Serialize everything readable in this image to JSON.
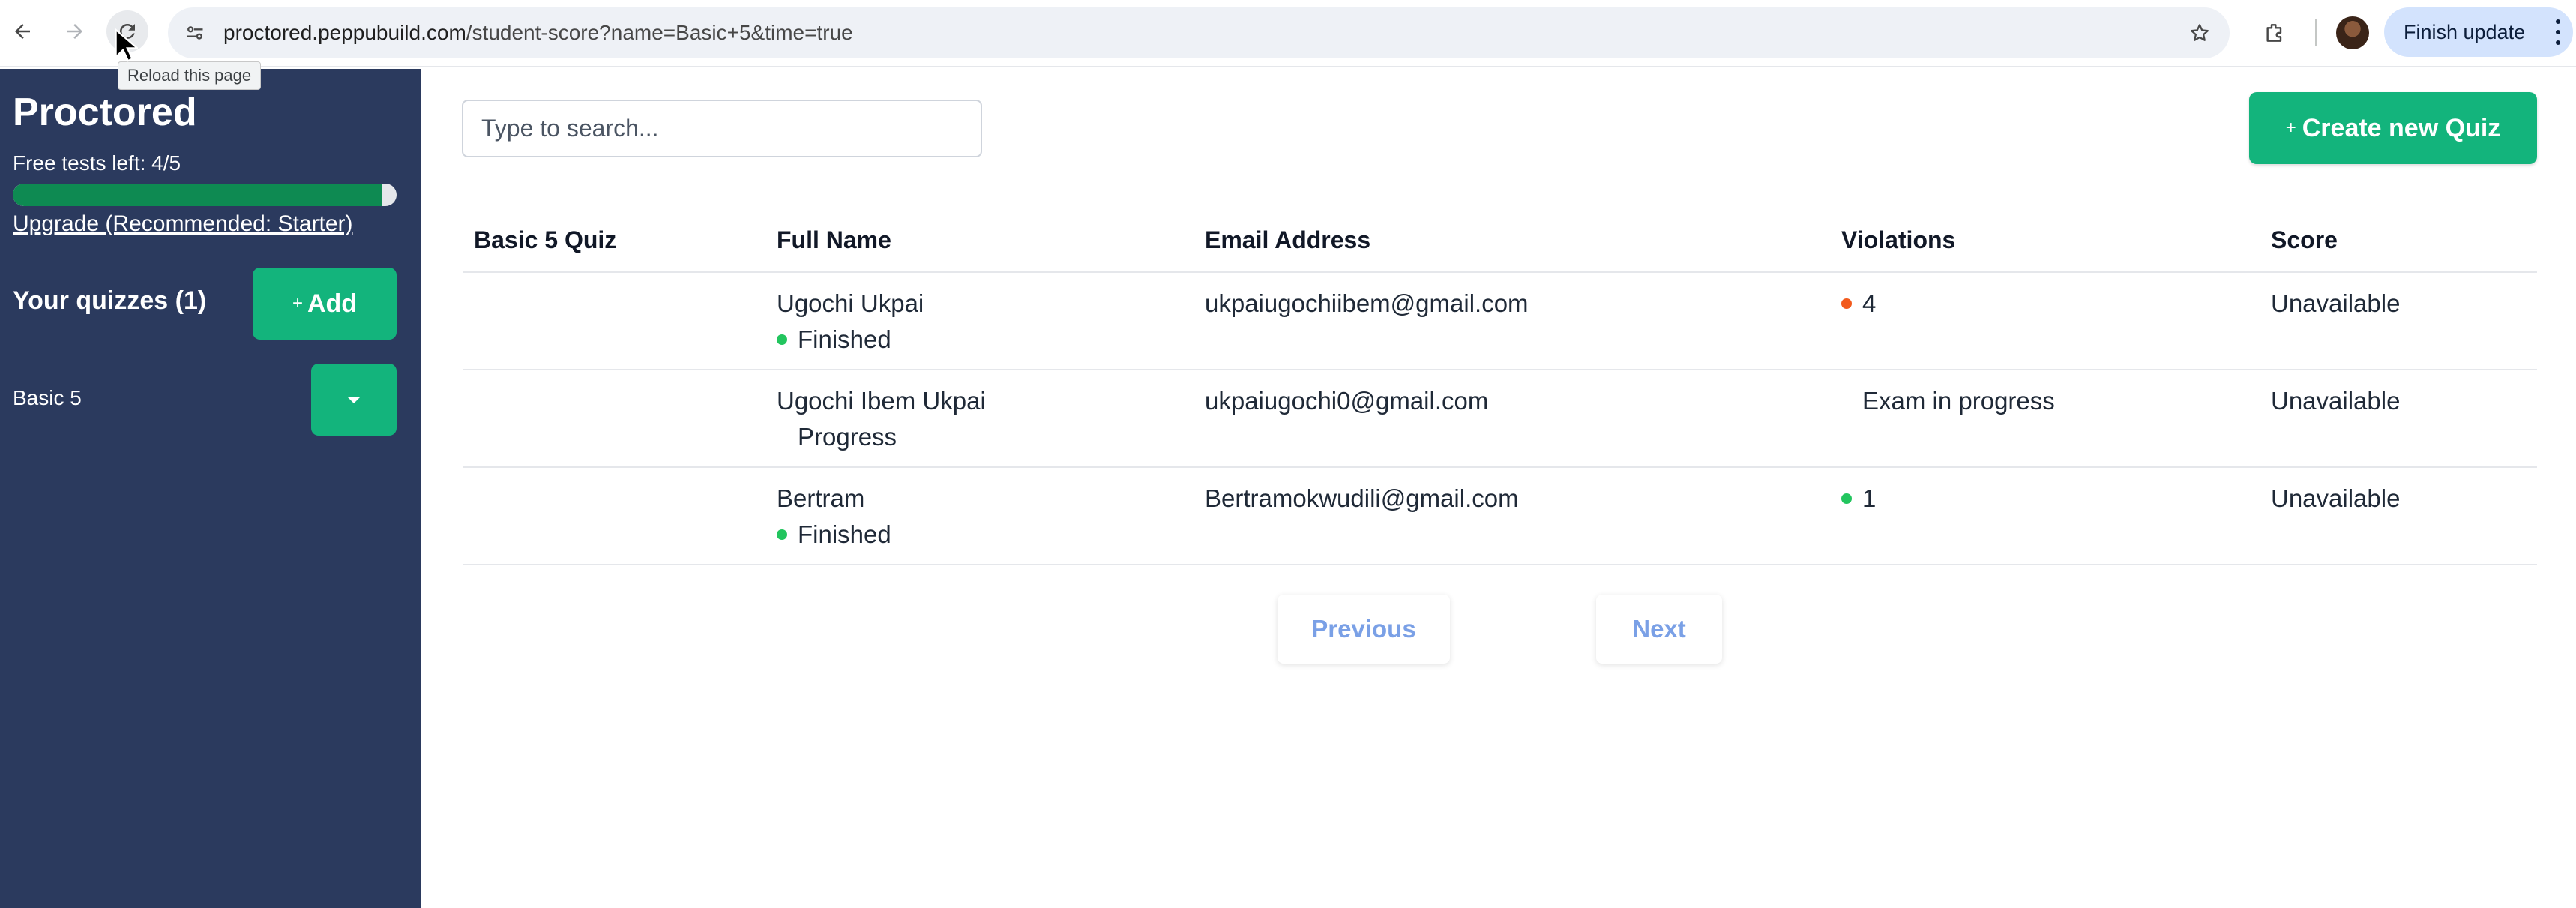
{
  "browser": {
    "url_domain": "proctored.peppubuild.com",
    "url_path": "/student-score?name=Basic+5&time=true",
    "reload_tooltip": "Reload this page",
    "finish_update_label": "Finish update",
    "icons": [
      "back-arrow-icon",
      "forward-arrow-icon",
      "reload-icon",
      "site-settings-icon",
      "bookmark-star-icon",
      "extensions-icon",
      "profile-avatar",
      "more-vertical-icon"
    ]
  },
  "sidebar": {
    "brand": "Proctored",
    "free_tests_label": "Free tests left: 4/5",
    "free_tests_fraction": 0.96,
    "upgrade_link": "Upgrade (Recommended: Starter)",
    "your_quizzes_label": "Your quizzes (1)",
    "add_button_plus": "+",
    "add_button_label": "Add",
    "quizzes": [
      {
        "name": "Basic 5"
      }
    ]
  },
  "main": {
    "search_placeholder": "Type to search...",
    "create_button_plus": "+",
    "create_button_label": "Create new Quiz",
    "table": {
      "headers": [
        "Basic 5 Quiz",
        "Full Name",
        "Email Address",
        "Violations",
        "Score"
      ],
      "rows": [
        {
          "full_name": "Ugochi Ukpai",
          "status": "Finished",
          "status_dot": "green",
          "email": "ukpaiugochiibem@gmail.com",
          "violations": "4",
          "violations_dot": "orange",
          "score": "Unavailable"
        },
        {
          "full_name": "Ugochi Ibem Ukpai",
          "status": "Progress",
          "status_dot": "none",
          "email": "ukpaiugochi0@gmail.com",
          "violations": "Exam in progress",
          "violations_dot": "none",
          "score": "Unavailable"
        },
        {
          "full_name": "Bertram",
          "status": "Finished",
          "status_dot": "green",
          "email": "Bertramokwudili@gmail.com",
          "violations": "1",
          "violations_dot": "green",
          "score": "Unavailable"
        }
      ]
    },
    "pagination": {
      "previous_label": "Previous",
      "next_label": "Next"
    }
  },
  "colors": {
    "sidebar_bg": "#2b3a5e",
    "accent_green": "#13b47c",
    "status_green": "#22c55e",
    "violation_orange": "#f25a1c",
    "pager_text": "#7aa0e6"
  }
}
